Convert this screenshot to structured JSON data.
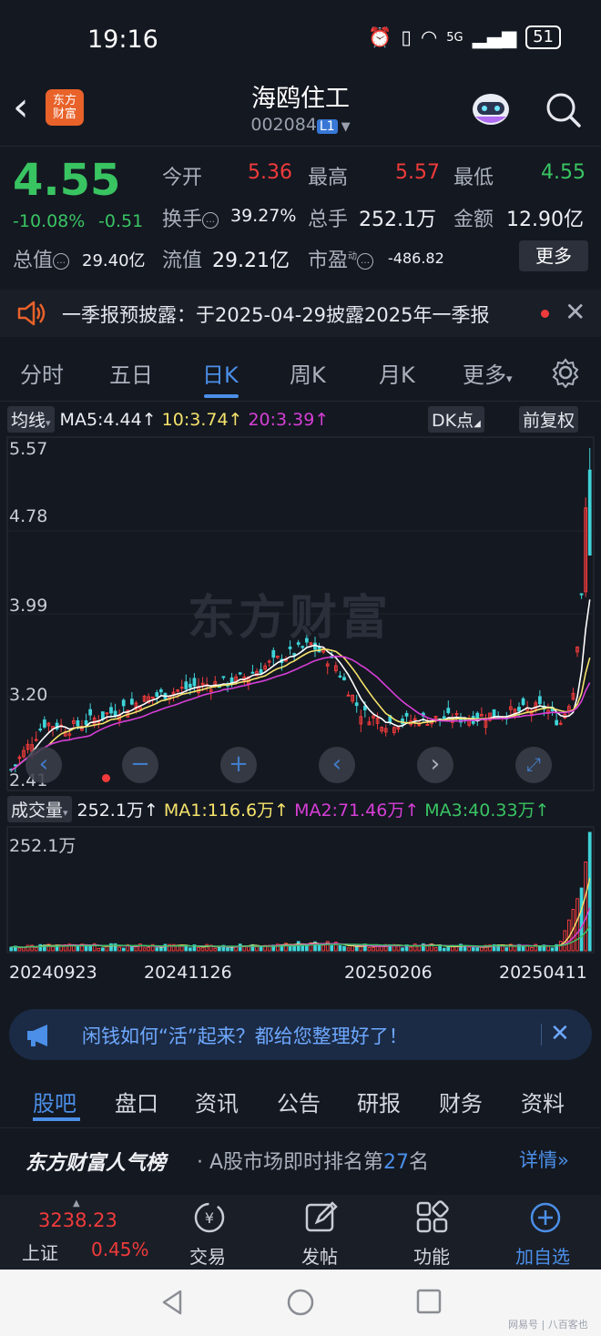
{
  "status_bar": {
    "time": "19:16",
    "battery": "51",
    "network": "5G"
  },
  "header": {
    "logo_text": "东方财富",
    "name": "海鸥住工",
    "code": "002084",
    "level": "L1"
  },
  "quote": {
    "price": "4.55",
    "change_pct": "-10.08%",
    "change": "-0.51",
    "open_label": "今开",
    "open": "5.36",
    "high_label": "最高",
    "high": "5.57",
    "low_label": "最低",
    "low": "4.55",
    "turnover_label": "换手",
    "turnover": "39.27%",
    "volume_label": "总手",
    "volume": "252.1万",
    "amount_label": "金额",
    "amount": "12.90亿",
    "mktcap_label": "总值",
    "mktcap": "29.40亿",
    "float_label": "流值",
    "float": "29.21亿",
    "pe_label": "市盈",
    "pe_sup": "动",
    "pe": "-486.82",
    "more_label": "更多"
  },
  "notice": {
    "text": "一季报预披露：于2025-04-29披露2025年一季报"
  },
  "chart_tabs": [
    "分时",
    "五日",
    "日K",
    "周K",
    "月K",
    "更多"
  ],
  "active_chart_tab": "日K",
  "kline": {
    "ma_label": "均线",
    "ma5": "MA5:4.44↑",
    "ma10": "10:3.74↑",
    "ma20": "20:3.39↑",
    "dk_label": "DK点",
    "adjust_label": "前复权",
    "y_ticks": [
      "5.57",
      "4.78",
      "3.99",
      "3.20",
      "2.41"
    ],
    "watermark": "东方财富"
  },
  "volume": {
    "label": "成交量",
    "vol": "252.1万↑",
    "ma1": "MA1:116.6万↑",
    "ma2": "MA2:71.46万↑",
    "ma3": "MA3:40.33万↑",
    "y_max": "252.1万"
  },
  "dates": [
    "20240923",
    "20241126",
    "20250206",
    "20250411"
  ],
  "colors": {
    "up": "#f03b3b",
    "down": "#39c462",
    "accent": "#4b8fe8",
    "ma5": "#ffffff",
    "ma10": "#f5e36b",
    "ma20": "#d63fd6",
    "vol_ma3": "#39c462"
  },
  "chart_data": {
    "type": "line",
    "title": "",
    "xlabel": "",
    "ylabel": "",
    "x": [
      "20240923",
      "20241126",
      "20250206",
      "20250411"
    ],
    "ylim": [
      2.41,
      5.57
    ],
    "series": [
      {
        "name": "MA5",
        "values": [
          2.6,
          3.45,
          3.0,
          4.44
        ]
      },
      {
        "name": "MA10",
        "values": [
          2.65,
          3.4,
          3.02,
          3.74
        ]
      },
      {
        "name": "MA20",
        "values": [
          2.7,
          3.35,
          3.04,
          3.39
        ]
      }
    ]
  },
  "ad": {
    "text": "闲钱如何“活”起来？都给您整理好了！"
  },
  "bottom_tabs": [
    "股吧",
    "盘口",
    "资讯",
    "公告",
    "研报",
    "财务",
    "资料"
  ],
  "active_bottom_tab": "股吧",
  "popularity": {
    "brand": "东方财富人气榜",
    "text_pre": "· A股市场即时排名第",
    "rank": "27",
    "text_post": "名",
    "detail": "详情"
  },
  "bottom_nav": {
    "index_value": "3238.23",
    "index_name": "上证",
    "index_change": "0.45%",
    "items": [
      "交易",
      "发帖",
      "功能",
      "加自选"
    ]
  },
  "watermark_footer": "网易号 | 八百客也"
}
